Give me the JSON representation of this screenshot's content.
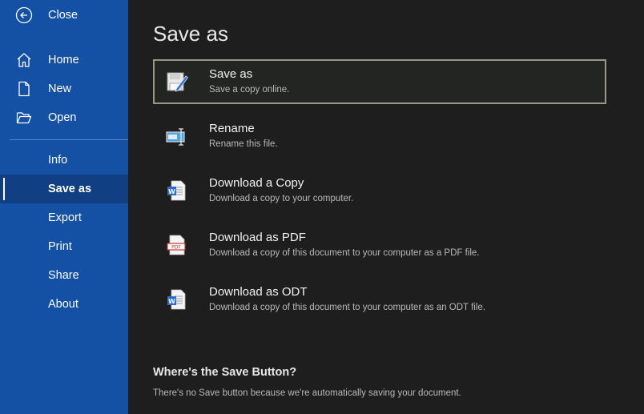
{
  "sidebar": {
    "close_label": "Close",
    "items": [
      {
        "label": "Home",
        "icon": "home-icon"
      },
      {
        "label": "New",
        "icon": "new-file-icon"
      },
      {
        "label": "Open",
        "icon": "folder-open-icon"
      },
      {
        "label": "Info"
      },
      {
        "label": "Save as",
        "active": true
      },
      {
        "label": "Export"
      },
      {
        "label": "Print"
      },
      {
        "label": "Share"
      },
      {
        "label": "About"
      }
    ]
  },
  "main": {
    "title": "Save as",
    "options": [
      {
        "title": "Save as",
        "desc": "Save a copy online.",
        "icon": "save-as-icon",
        "selected": true
      },
      {
        "title": "Rename",
        "desc": "Rename this file.",
        "icon": "rename-icon"
      },
      {
        "title": "Download a Copy",
        "desc": "Download a copy to your computer.",
        "icon": "word-document-icon"
      },
      {
        "title": "Download as PDF",
        "desc": "Download a copy of this document to your computer as a PDF file.",
        "icon": "pdf-icon"
      },
      {
        "title": "Download as ODT",
        "desc": "Download a copy of this document to your computer as an ODT file.",
        "icon": "odt-document-icon"
      }
    ],
    "where": {
      "title": "Where's the Save Button?",
      "desc": "There's no Save button because we're automatically saving your document."
    }
  },
  "colors": {
    "sidebar_bg": "#1450a3",
    "sidebar_active": "#103f83",
    "main_bg": "#1e1e1e",
    "selected_border": "#9a9788"
  }
}
